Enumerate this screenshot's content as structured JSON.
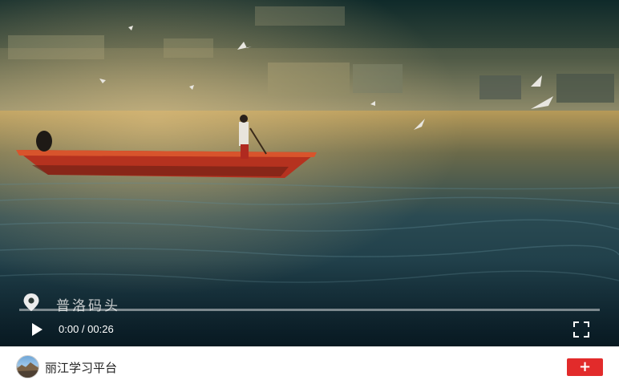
{
  "video": {
    "location_caption": "普洛码头",
    "current_time": "0:00",
    "time_separator": "/",
    "duration": "0:26",
    "time_display": "0:00 / 00:26",
    "progress_fraction": 0.0,
    "icons": {
      "location": "location-pin-icon",
      "play": "play-icon",
      "fullscreen": "fullscreen-icon"
    }
  },
  "footer": {
    "account_name": "丽江学习平台",
    "follow_label": "+",
    "accent_color": "#e22b2b"
  }
}
